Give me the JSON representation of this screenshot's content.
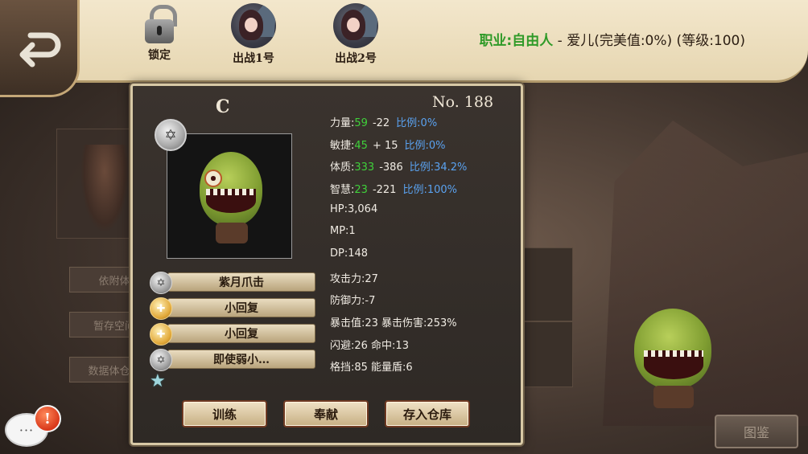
{
  "header": {
    "tabs": [
      {
        "label": "锁定",
        "icon": "lock-icon"
      },
      {
        "label": "出战1号",
        "icon": "character-portrait"
      },
      {
        "label": "出战2号",
        "icon": "character-portrait"
      }
    ],
    "job_label": "职业:自由人",
    "char_info_rest": " - 爱儿(完美值:0%) (等级:100)"
  },
  "pet": {
    "grade": "C",
    "number": "No. 188",
    "stats": {
      "str": {
        "label": "力量:",
        "value": "59",
        "mod": "-22",
        "ratio": "比例:0%"
      },
      "agi": {
        "label": "敏捷:",
        "value": "45",
        "mod": "+ 15",
        "ratio": "比例:0%"
      },
      "con": {
        "label": "体质:",
        "value": "333",
        "mod": "-386",
        "ratio": "比例:34.2%"
      },
      "wis": {
        "label": "智慧:",
        "value": "23",
        "mod": "-221",
        "ratio": "比例:100%"
      }
    },
    "hp": "HP:3,064",
    "mp": "MP:1",
    "dp": "DP:148",
    "atk": "攻击力:27",
    "def": "防御力:-7",
    "crit": "暴击值:23 暴击伤害:253%",
    "dodge": "闪避:26 命中:13",
    "block": "格挡:85 能量盾:6"
  },
  "skills": [
    {
      "name": "紫月爪击",
      "icon": "silver"
    },
    {
      "name": "小回复",
      "icon": "gold"
    },
    {
      "name": "小回复",
      "icon": "gold"
    },
    {
      "name": "即使弱小…",
      "icon": "silver"
    }
  ],
  "actions": {
    "train": "训练",
    "donate": "奉献",
    "store": "存入仓库"
  },
  "background": {
    "btn1": "依附体",
    "btn2": "暂存空间",
    "btn3": "数据体仓库",
    "illustrated": "图鉴"
  },
  "chat": {
    "dots": "···",
    "alert": "!"
  },
  "colors": {
    "stat_value": "#3fd13a",
    "ratio": "#5aa2f0",
    "job": "#2f9a28"
  }
}
